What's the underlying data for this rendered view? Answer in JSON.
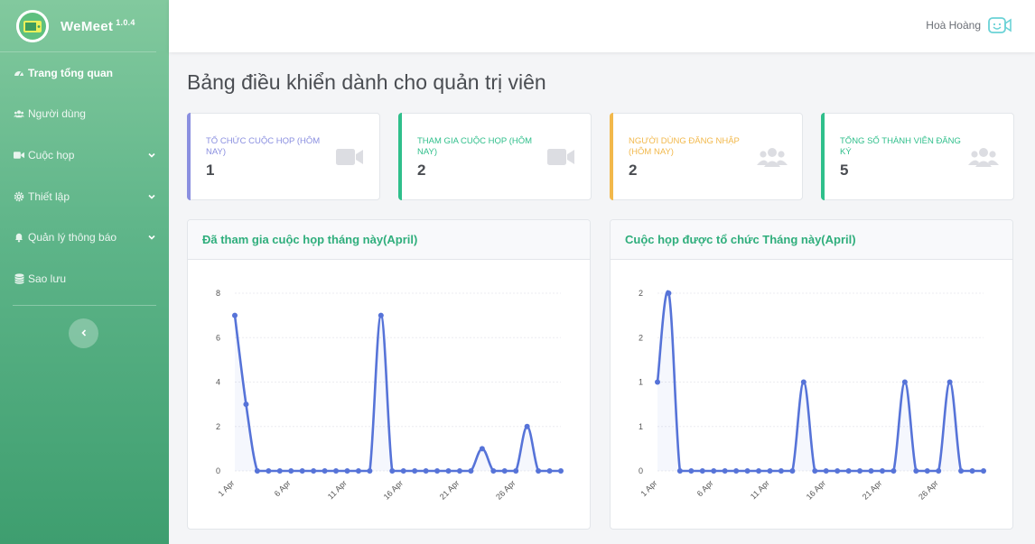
{
  "app": {
    "name": "WeMeet",
    "version": "1.0.4"
  },
  "sidebar": {
    "items": [
      {
        "label": "Trang tổng quan",
        "icon": "dashboard-icon",
        "active": true,
        "caret": false
      },
      {
        "label": "Người dùng",
        "icon": "users-icon",
        "active": false,
        "caret": false
      },
      {
        "label": "Cuộc họp",
        "icon": "video-icon",
        "active": false,
        "caret": true
      },
      {
        "label": "Thiết lập",
        "icon": "gear-icon",
        "active": false,
        "caret": true
      },
      {
        "label": "Quản lý thông báo",
        "icon": "bell-icon",
        "active": false,
        "caret": true
      },
      {
        "label": "Sao lưu",
        "icon": "database-icon",
        "active": false,
        "caret": false
      }
    ]
  },
  "topbar": {
    "user_name": "Hoà Hoàng"
  },
  "page": {
    "title": "Bảng điều khiển dành cho quản trị viên"
  },
  "cards": [
    {
      "label": "TỔ CHỨC CUỘC HỌP (HÔM NAY)",
      "value": "1",
      "color": "#8a8fe0",
      "icon": "video-camera-icon"
    },
    {
      "label": "THAM GIA CUỘC HỌP (HÔM NAY)",
      "value": "2",
      "color": "#2fbf8b",
      "icon": "video-camera-icon"
    },
    {
      "label": "NGƯỜI DÙNG ĐĂNG NHẬP (HÔM NAY)",
      "value": "2",
      "color": "#f2b84b",
      "icon": "users-group-icon"
    },
    {
      "label": "TỔNG SỐ THÀNH VIÊN ĐĂNG KÝ",
      "value": "5",
      "color": "#2fbf8b",
      "icon": "users-group-icon"
    }
  ],
  "colors": {
    "accent": "#2fae7c",
    "line": "#5673d8"
  },
  "chart_data": [
    {
      "type": "line",
      "title": "Đã tham gia cuộc họp tháng này(April)",
      "x": [
        "1 Apr",
        "2 Apr",
        "3 Apr",
        "4 Apr",
        "5 Apr",
        "6 Apr",
        "7 Apr",
        "8 Apr",
        "9 Apr",
        "10 Apr",
        "11 Apr",
        "12 Apr",
        "13 Apr",
        "14 Apr",
        "15 Apr",
        "16 Apr",
        "17 Apr",
        "18 Apr",
        "19 Apr",
        "20 Apr",
        "21 Apr",
        "22 Apr",
        "23 Apr",
        "24 Apr",
        "25 Apr",
        "26 Apr",
        "27 Apr",
        "28 Apr",
        "29 Apr",
        "30 Apr"
      ],
      "x_tick_labels": [
        "1 Apr",
        "6 Apr",
        "11 Apr",
        "16 Apr",
        "21 Apr",
        "26 Apr"
      ],
      "values": [
        7,
        3,
        0,
        0,
        0,
        0,
        0,
        0,
        0,
        0,
        0,
        0,
        0,
        7,
        0,
        0,
        0,
        0,
        0,
        0,
        0,
        0,
        1,
        0,
        0,
        0,
        2,
        0,
        0,
        0
      ],
      "y_tick_labels": [
        "0",
        "2",
        "4",
        "6",
        "8"
      ],
      "ylim": [
        0,
        8
      ],
      "grid": true,
      "legend": false
    },
    {
      "type": "line",
      "title": "Cuộc họp được tổ chức Tháng này(April)",
      "x": [
        "1 Apr",
        "2 Apr",
        "3 Apr",
        "4 Apr",
        "5 Apr",
        "6 Apr",
        "7 Apr",
        "8 Apr",
        "9 Apr",
        "10 Apr",
        "11 Apr",
        "12 Apr",
        "13 Apr",
        "14 Apr",
        "15 Apr",
        "16 Apr",
        "17 Apr",
        "18 Apr",
        "19 Apr",
        "20 Apr",
        "21 Apr",
        "22 Apr",
        "23 Apr",
        "24 Apr",
        "25 Apr",
        "26 Apr",
        "27 Apr",
        "28 Apr",
        "29 Apr",
        "30 Apr"
      ],
      "x_tick_labels": [
        "1 Apr",
        "6 Apr",
        "11 Apr",
        "16 Apr",
        "21 Apr",
        "26 Apr"
      ],
      "values": [
        1,
        2,
        0,
        0,
        0,
        0,
        0,
        0,
        0,
        0,
        0,
        0,
        0,
        1,
        0,
        0,
        0,
        0,
        0,
        0,
        0,
        0,
        1,
        0,
        0,
        0,
        1,
        0,
        0,
        0
      ],
      "y_tick_labels": [
        "0",
        "1",
        "1",
        "2",
        "2"
      ],
      "ylim": [
        0,
        2
      ],
      "grid": true,
      "legend": false
    }
  ]
}
